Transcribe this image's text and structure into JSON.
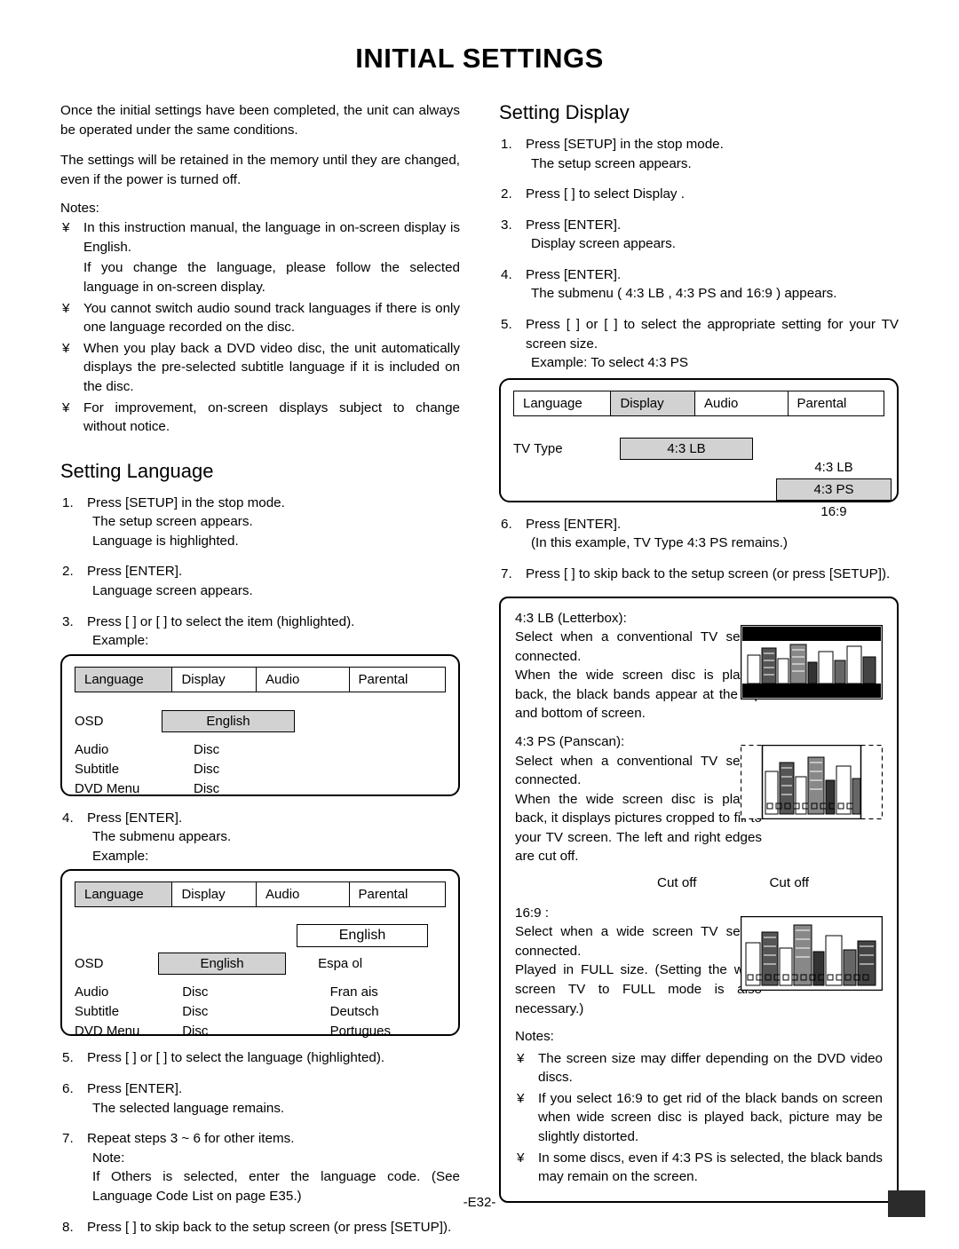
{
  "page": {
    "title": "INITIAL SETTINGS",
    "footer": "-E32-"
  },
  "intro": {
    "p1": "Once the initial settings have been completed, the unit can always be operated under the same conditions.",
    "p2": "The settings will be retained in the memory until they are changed, even if the power is turned off.",
    "notes_label": "Notes:",
    "bullet": "¥",
    "notes": [
      "In this instruction manual, the language in on-screen display is English.",
      "If you change the language, please follow the selected language in on-screen display.",
      "You cannot switch audio sound track languages if there is only one language recorded on the disc.",
      "When you play back a DVD video disc, the unit automatically displays the pre-selected subtitle language if it is included on the disc.",
      "For improvement, on-screen displays subject to change without notice."
    ],
    "notes_bulleted": [
      true,
      false,
      true,
      true,
      true
    ]
  },
  "setting_language": {
    "heading": "Setting Language",
    "steps": [
      {
        "num": "1.",
        "text": "Press [SETUP] in the stop mode.",
        "sub": [
          "The setup screen appears.",
          " Language  is highlighted."
        ]
      },
      {
        "num": "2.",
        "text": "Press [ENTER].",
        "sub": [
          " Language  screen appears."
        ]
      },
      {
        "num": "3.",
        "text": "Press [   ] or [   ] to select the item (highlighted).",
        "sub": [
          "Example:"
        ]
      },
      {
        "num": "4.",
        "text": "Press [ENTER].",
        "sub": [
          "The submenu appears.",
          "Example:"
        ]
      },
      {
        "num": "5.",
        "text": "Press [   ] or [   ] to select the language (highlighted).",
        "sub": []
      },
      {
        "num": "6.",
        "text": "Press [ENTER].",
        "sub": [
          "The selected language remains."
        ]
      },
      {
        "num": "7.",
        "text": "Repeat steps 3 ~ 6 for other items.",
        "sub": [
          "Note:",
          "If  Others  is selected, enter the language code. (See  Language Code List  on page E35.)"
        ]
      },
      {
        "num": "8.",
        "text": "Press [   ] to skip back to the setup screen (or press [SETUP]).",
        "sub": []
      }
    ]
  },
  "osd_menu_1": {
    "tabs": [
      "Language",
      "Display",
      "Audio",
      "Parental"
    ],
    "selected_tab": "Language",
    "rows": [
      {
        "label": "OSD",
        "value": "English",
        "highlight": true
      },
      {
        "label": "Audio",
        "value": "Disc",
        "highlight": false
      },
      {
        "label": "Subtitle",
        "value": "Disc",
        "highlight": false
      },
      {
        "label": "DVD Menu",
        "value": "Disc",
        "highlight": false
      }
    ]
  },
  "osd_menu_2": {
    "tabs": [
      "Language",
      "Display",
      "Audio",
      "Parental"
    ],
    "selected_tab": "Language",
    "rows": [
      {
        "label": "OSD",
        "value": "English",
        "highlight": true,
        "value2": "Espa ol"
      },
      {
        "label": "Audio",
        "value": "Disc",
        "highlight": false,
        "value2": "Fran ais"
      },
      {
        "label": "Subtitle",
        "value": "Disc",
        "highlight": false,
        "value2": "Deutsch"
      },
      {
        "label": "DVD Menu",
        "value": "Disc",
        "highlight": false,
        "value2": "Portugues"
      }
    ],
    "popup_top": "English"
  },
  "setting_display": {
    "heading": "Setting Display",
    "steps": [
      {
        "num": "1.",
        "text": "Press [SETUP] in the stop mode.",
        "sub": [
          "The setup screen appears."
        ]
      },
      {
        "num": "2.",
        "text": "Press [   ] to select  Display .",
        "sub": []
      },
      {
        "num": "3.",
        "text": "Press [ENTER].",
        "sub": [
          " Display  screen appears."
        ]
      },
      {
        "num": "4.",
        "text": "Press [ENTER].",
        "sub": [
          "The submenu (  4:3 LB ,  4:3 PS  and  16:9 ) appears."
        ]
      },
      {
        "num": "5.",
        "text": "Press [   ] or [   ] to select the appropriate setting for your TV screen size.",
        "sub": [
          "Example: To select  4:3 PS "
        ]
      },
      {
        "num": "6.",
        "text": "Press [ENTER].",
        "sub": [
          "(In this example,  TV Type 4:3 PS  remains.)"
        ]
      },
      {
        "num": "7.",
        "text": "Press [   ] to skip back to the setup screen (or press [SETUP]).",
        "sub": []
      }
    ]
  },
  "osd_menu_display": {
    "tabs": [
      "Language",
      "Display",
      "Audio",
      "Parental"
    ],
    "selected_tab": "Display",
    "row_label": "TV Type",
    "row_value": "4:3 LB",
    "options": [
      "4:3 LB",
      "4:3 PS",
      "16:9"
    ],
    "selected_option": "4:3 PS"
  },
  "tv_types": {
    "blocks": [
      {
        "title": "4:3 LB  (Letterbox):",
        "text": "Select when a conventional TV set is connected.\nWhen the wide screen disc is played back, the black bands appear at the top and bottom of screen.",
        "picture": "letterbox"
      },
      {
        "title": "4:3 PS  (Panscan):",
        "text": "Select when a conventional TV set is connected.\nWhen the wide screen disc is played back, it displays pictures cropped to fill to your TV screen. The left and right edges are cut off.",
        "picture": "panscan",
        "captions": [
          "Cut off",
          "Cut off"
        ]
      },
      {
        "title": "16:9 :",
        "text": "Select when a wide screen TV set is connected.\nPlayed in  FULL  size. (Setting the wide screen TV to  FULL  mode is also necessary.)",
        "picture": "widescreen"
      }
    ],
    "notes_label": "Notes:",
    "bullet": "¥",
    "notes": [
      "The screen size may differ depending on the DVD video discs.",
      "If you select 16:9 to get rid of the black bands on screen when wide screen disc is played back, picture may be slightly distorted.",
      "In some discs, even if 4:3 PS is selected, the black bands may remain on the screen."
    ]
  }
}
